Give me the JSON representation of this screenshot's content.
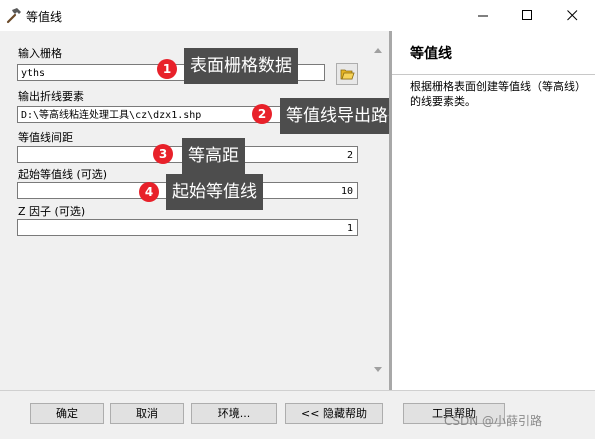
{
  "window": {
    "title": "等值线",
    "icon": "hammer-icon",
    "controls": [
      "minimize-icon",
      "maximize-icon",
      "close-icon"
    ]
  },
  "form": {
    "input_raster": {
      "label": "输入栅格",
      "value": "yths"
    },
    "output_polyline": {
      "label": "输出折线要素",
      "value": "D:\\等高线粘连处理工具\\cz\\dzx1.shp"
    },
    "contour_interval": {
      "label": "等值线间距",
      "value": "2"
    },
    "base_contour": {
      "label": "起始等值线 (可选)",
      "value": "10"
    },
    "z_factor": {
      "label": "Z 因子 (可选)",
      "value": "1"
    }
  },
  "annotations": [
    {
      "number": "1",
      "text": "表面栅格数据"
    },
    {
      "number": "2",
      "text": "等值线导出路径"
    },
    {
      "number": "3",
      "text": "等高距"
    },
    {
      "number": "4",
      "text": "起始等值线"
    }
  ],
  "help": {
    "title": "等值线",
    "body": "根据栅格表面创建等值线（等高线）的线要素类。"
  },
  "buttons": {
    "ok": "确定",
    "cancel": "取消",
    "environments": "环境...",
    "hide_help": "<< 隐藏帮助",
    "tool_help": "工具帮助"
  },
  "watermark": "CSDN @小薛引路",
  "colors": {
    "badge": "#e8212a",
    "callout_bg": "#4d4d4d",
    "panel_bg": "#f0f0f0"
  }
}
